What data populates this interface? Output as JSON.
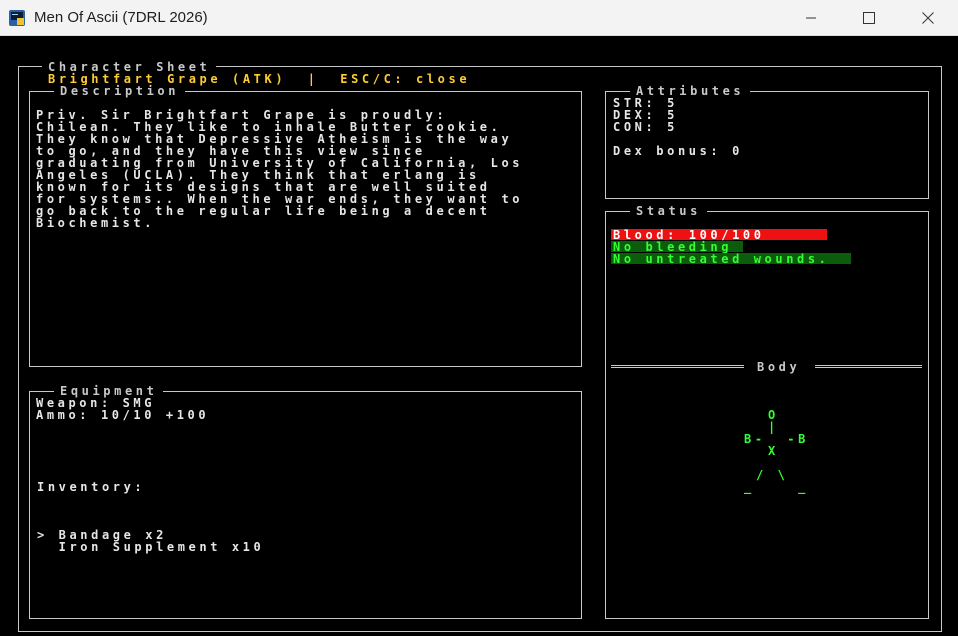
{
  "window": {
    "title": "Men Of Ascii (7DRL 2026)",
    "controls": [
      "minimize-icon",
      "maximize-icon",
      "close-icon"
    ]
  },
  "sheet": {
    "title": "Character Sheet",
    "header_line": "Brightfart Grape (ATK)  |  ESC/C: close"
  },
  "description": {
    "title": "Description",
    "lines": [
      "Priv. Sir Brightfart Grape is proudly:",
      "Chilean. They like to inhale Butter cookie.",
      "They know that Depressive Atheism is the way",
      "to go, and they have this view since",
      "graduating from University of California, Los",
      "Angeles (UCLA). They think that erlang is",
      "known for its designs that are well suited",
      "for systems.. When the war ends, they want to",
      "go back to the regular life being a decent",
      "Biochemist."
    ]
  },
  "attributes": {
    "title": "Attributes",
    "str": "STR: 5",
    "dex": "DEX: 5",
    "con": "CON: 5",
    "dex_bonus": "Dex bonus: 0"
  },
  "status": {
    "title": "Status",
    "blood": "Blood: 100/100",
    "bleeding": "No bleeding",
    "wounds": "No untreated wounds.",
    "colors": {
      "blood_bar": "#ee1111",
      "ok_text": "#33ff33",
      "ok_bg": "#0b5d0b"
    }
  },
  "body": {
    "title": "Body",
    "figure": {
      "head": "O",
      "neck": "|",
      "arms": "B-  -B",
      "torso": "X",
      "legs": "/ \\",
      "feet": "_    _"
    }
  },
  "equipment": {
    "title": "Equipment",
    "weapon": "Weapon: SMG",
    "ammo": "Ammo: 10/10 +100",
    "inventory_label": "Inventory:",
    "items": [
      "> Bandage x2",
      "  Iron Supplement x10"
    ]
  }
}
